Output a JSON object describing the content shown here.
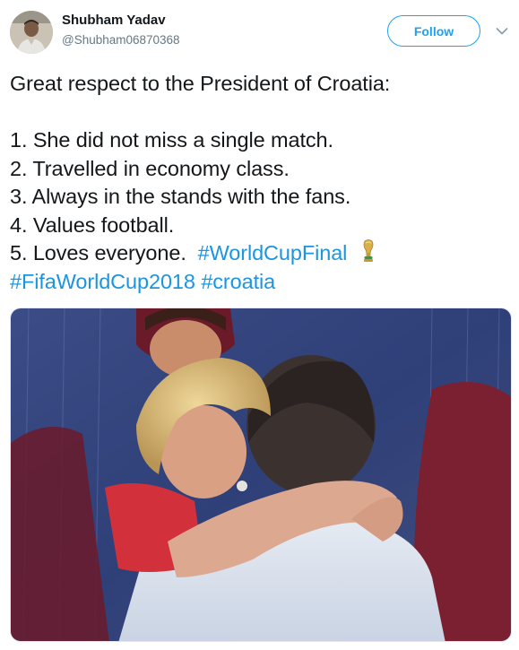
{
  "user": {
    "name": "Shubham Yadav",
    "handle": "@Shubham06870368"
  },
  "actions": {
    "follow_label": "Follow"
  },
  "tweet": {
    "intro": "Great respect to the President of Croatia:",
    "items": [
      "1. She did not miss a single match.",
      "2. Travelled in economy class.",
      "3. Always in the stands with the fans.",
      "4. Values football.",
      "5. Loves everyone."
    ],
    "hashtags": [
      "#WorldCupFinal",
      "#FifaWorldCup2018",
      "#croatia"
    ]
  },
  "colors": {
    "link": "#1b95e0",
    "follow_border": "#1da1f2",
    "handle": "#657786"
  },
  "icons": {
    "trophy": "world-cup-trophy-emoji",
    "caret": "chevron-down-icon"
  }
}
